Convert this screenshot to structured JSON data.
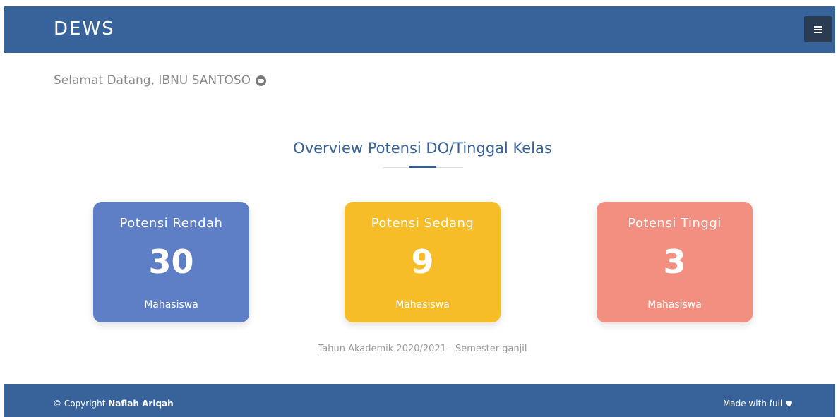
{
  "header": {
    "brand": "DEWS",
    "menu_icon": "hamburger-menu-icon"
  },
  "welcome": {
    "text": "Selamat Datang, IBNU SANTOSO",
    "icon": "mask-icon"
  },
  "overview": {
    "title": "Overview Potensi DO/Tinggal Kelas",
    "cards": [
      {
        "title": "Potensi Rendah",
        "value": "30",
        "unit": "Mahasiswa",
        "color": "#5e7fc6"
      },
      {
        "title": "Potensi Sedang",
        "value": "9",
        "unit": "Mahasiswa",
        "color": "#f6bd29"
      },
      {
        "title": "Potensi Tinggi",
        "value": "3",
        "unit": "Mahasiswa",
        "color": "#f28f80"
      }
    ],
    "academic_year": "Tahun Akademik 2020/2021 - Semester ganjil"
  },
  "footer": {
    "copyright_prefix": "© Copyright",
    "author": "Naflah Ariqah",
    "made_with": "Made with full",
    "heart_icon": "heart-icon"
  },
  "colors": {
    "primary": "#37629a",
    "menu_button": "#2a3b52",
    "text_muted": "#8a8a8a"
  }
}
